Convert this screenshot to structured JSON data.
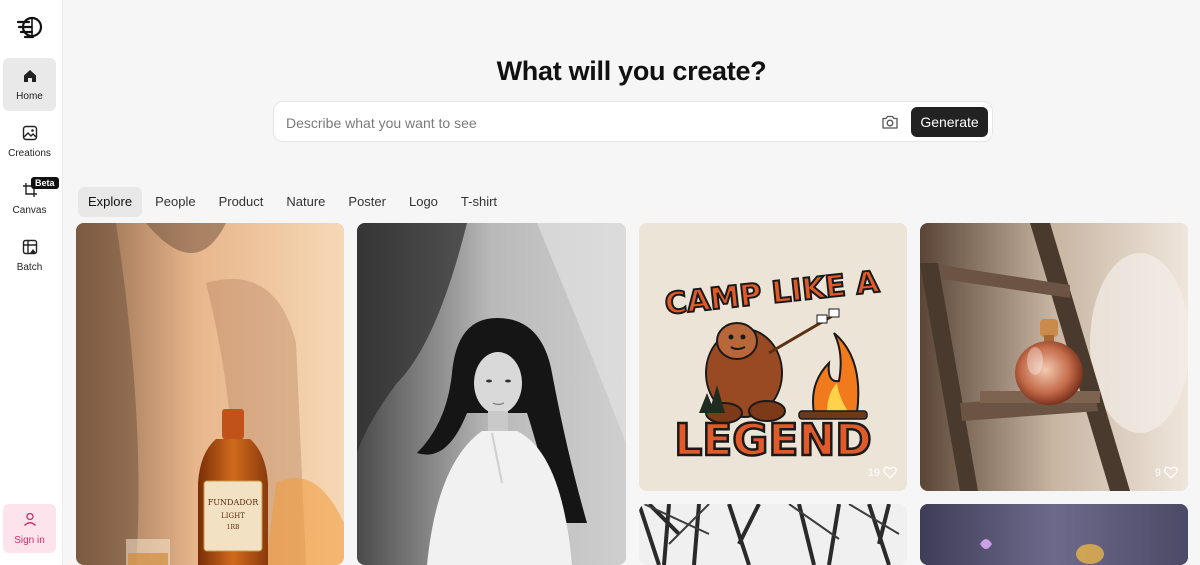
{
  "sidebar": {
    "items": [
      {
        "label": "Home",
        "icon": "home-icon"
      },
      {
        "label": "Creations",
        "icon": "image-icon"
      },
      {
        "label": "Canvas",
        "icon": "crop-icon"
      },
      {
        "label": "Batch",
        "icon": "batch-icon"
      }
    ],
    "beta_badge": "Beta",
    "signin_label": "Sign in"
  },
  "main": {
    "headline": "What will you create?",
    "search_placeholder": "Describe what you want to see",
    "generate_label": "Generate",
    "tabs": [
      "Explore",
      "People",
      "Product",
      "Nature",
      "Poster",
      "Logo",
      "T-shirt"
    ]
  },
  "gallery": {
    "cards": [
      {
        "subject": "FUNDADOR bottle",
        "bottle_text": [
          "FUNDADOR",
          "LIGHT",
          "1RB"
        ]
      },
      {
        "subject": "girl portrait"
      },
      {
        "subject": "camp legend tshirt",
        "text_top": "CAMP LIKE A",
        "text_bottom": "LEGEND",
        "likes": "19"
      },
      {
        "subject": "perfume on ladder",
        "likes": "9"
      }
    ]
  },
  "colors": {
    "accent_dark": "#222222",
    "signin_bg": "#fde3ec",
    "signin_text": "#d0306a"
  }
}
